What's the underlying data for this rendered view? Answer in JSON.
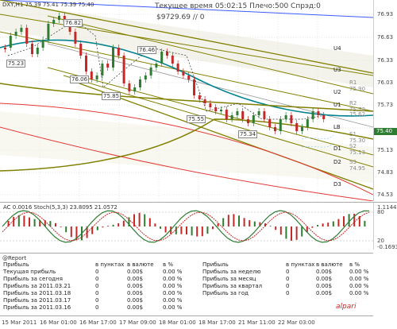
{
  "symbol_info": "DXY,H1  75.39 75.41 75.39 75.40",
  "status_line": "Текущее время 05:02:15 Плечо:500 Спрэд:0",
  "balance": "$9729.69     // 0",
  "indicator_header": "AC 0.0016  Stoch(5,3,3) 23.8095 21.0572",
  "price_axis": [
    "76.93",
    "76.63",
    "76.33",
    "76.03",
    "75.73",
    "75.43",
    "75.13",
    "74.83",
    "74.53"
  ],
  "current_price": "75.40",
  "level_labels": [
    "U4",
    "U3",
    "U2",
    "U1",
    "LB",
    "D1",
    "D2",
    "D3"
  ],
  "price_tags": [
    "75.23",
    "76.82",
    "76.06",
    "75.85",
    "76.46",
    "75.55",
    "75.34"
  ],
  "small_tags": [
    "R1 75.90",
    "R2 75.73",
    "75.62",
    "S1 75.30",
    "S2 75.13",
    "S3 74.95"
  ],
  "ind_axis": [
    "1.1144",
    "80",
    "20",
    "-0.1693"
  ],
  "report": {
    "title": "@Report",
    "headers_left": [
      "Прибыль",
      "в пунктах",
      "в валюте",
      "в %"
    ],
    "headers_right": [
      "Прибыль",
      "в пунктах",
      "в валюте",
      "в %"
    ],
    "rows_left": [
      [
        "Текущая прибыль",
        "0",
        "0.00$",
        "0.00 %"
      ],
      [
        "Прибыль за сегодня",
        "0",
        "0.00$",
        "0.00 %"
      ],
      [
        "Прибыль за 2011.03.21",
        "0",
        "0.00$",
        "0.00 %"
      ],
      [
        "Прибыль за 2011.03.18",
        "0",
        "0.00$",
        "0.00 %"
      ],
      [
        "Прибыль за 2011.03.17",
        "0",
        "0.00$",
        "0.00 %"
      ],
      [
        "Прибыль за 2011.03.16",
        "0",
        "0.00$",
        "0.00 %"
      ]
    ],
    "rows_right": [
      [
        "Прибыль за неделю",
        "0",
        "0.00$",
        "0.00 %"
      ],
      [
        "Прибыль за месяц",
        "0",
        "0.00$",
        "0.00 %"
      ],
      [
        "Прибыль за квартал",
        "0",
        "0.00$",
        "0.00 %"
      ],
      [
        "Прибыль за год",
        "0",
        "0.00$",
        "0.00 %"
      ]
    ]
  },
  "logo": "alpari",
  "time_axis": [
    "15 Mar 2011",
    "16 Mar 01:00",
    "16 Mar 17:00",
    "17 Mar 09:00",
    "18 Mar 01:00",
    "18 Mar 17:00",
    "21 Mar 11:00",
    "22 Mar 03:00"
  ],
  "colors": {
    "bull": "#2e7d32",
    "bear": "#c62828",
    "channel": "#808000",
    "mid": "#00838f",
    "upper": "#3d5afe",
    "lower": "#e53935",
    "stoch_main": "#2e7d32",
    "stoch_signal": "#c62828"
  }
}
